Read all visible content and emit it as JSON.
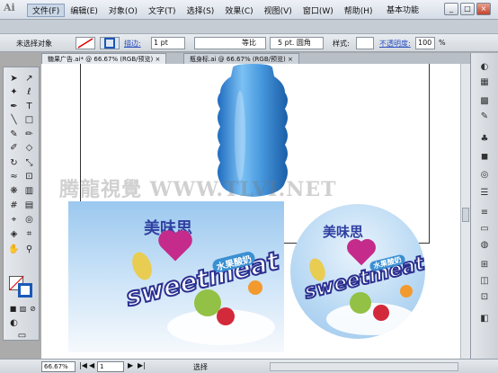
{
  "app": {
    "logo": "Ai",
    "workspace": "基本功能",
    "window_buttons": [
      "_",
      "□",
      "×"
    ]
  },
  "menu": [
    "文件(F)",
    "编辑(E)",
    "对象(O)",
    "文字(T)",
    "选择(S)",
    "效果(C)",
    "视图(V)",
    "窗口(W)",
    "帮助(H)"
  ],
  "control": {
    "selection": "未选择对象",
    "stroke_label": "描边:",
    "stroke_width": "1 pt",
    "profile": "等比",
    "brush": "5 pt. 圆角",
    "style_label": "样式:",
    "opacity_label": "不透明度:",
    "opacity": "100",
    "opacity_unit": "%"
  },
  "tabs": [
    {
      "label": "糖果广告.ai* @ 66.67% (RGB/预览)",
      "close": "×"
    },
    {
      "label": "瓶身标.ai @ 66.67% (RGB/预览)",
      "close": "×"
    }
  ],
  "artwork": {
    "brand_cn": "美味思",
    "brand_en": "sweetmeat",
    "product_cn": "水果酸奶"
  },
  "watermark": "腾龍視覺 WWW.TLVI.NET",
  "status": {
    "zoom": "66.67%",
    "page": "1",
    "tool": "选择"
  },
  "colors": {
    "bottle": "#4a9be0",
    "brand_blue": "#2a2f8f",
    "sky": "#9bc8ef",
    "stroke_swatch": "#1a57b8"
  },
  "tool_icons": [
    "selection-tool",
    "direct-selection-tool",
    "magic-wand-tool",
    "lasso-tool",
    "pen-tool",
    "type-tool",
    "line-tool",
    "rectangle-tool",
    "paintbrush-tool",
    "pencil-tool",
    "blob-brush-tool",
    "eraser-tool",
    "rotate-tool",
    "scale-tool",
    "warp-tool",
    "free-transform-tool",
    "symbol-sprayer-tool",
    "column-graph-tool",
    "mesh-tool",
    "gradient-tool",
    "eyedropper-tool",
    "blend-tool",
    "live-paint-tool",
    "slice-tool",
    "hand-tool",
    "zoom-tool"
  ],
  "panel_icons": [
    "color-panel-icon",
    "color-guide-icon",
    "swatches-icon",
    "brushes-icon",
    "symbols-icon",
    "graphic-styles-icon",
    "appearance-icon",
    "layers-icon",
    "stroke-icon",
    "gradient-icon",
    "transparency-icon",
    "align-icon",
    "pathfinder-icon",
    "transform-icon",
    "artboards-icon",
    "links-icon",
    "text-icon",
    "character-icon",
    "paragraph-icon",
    "opentype-icon"
  ]
}
